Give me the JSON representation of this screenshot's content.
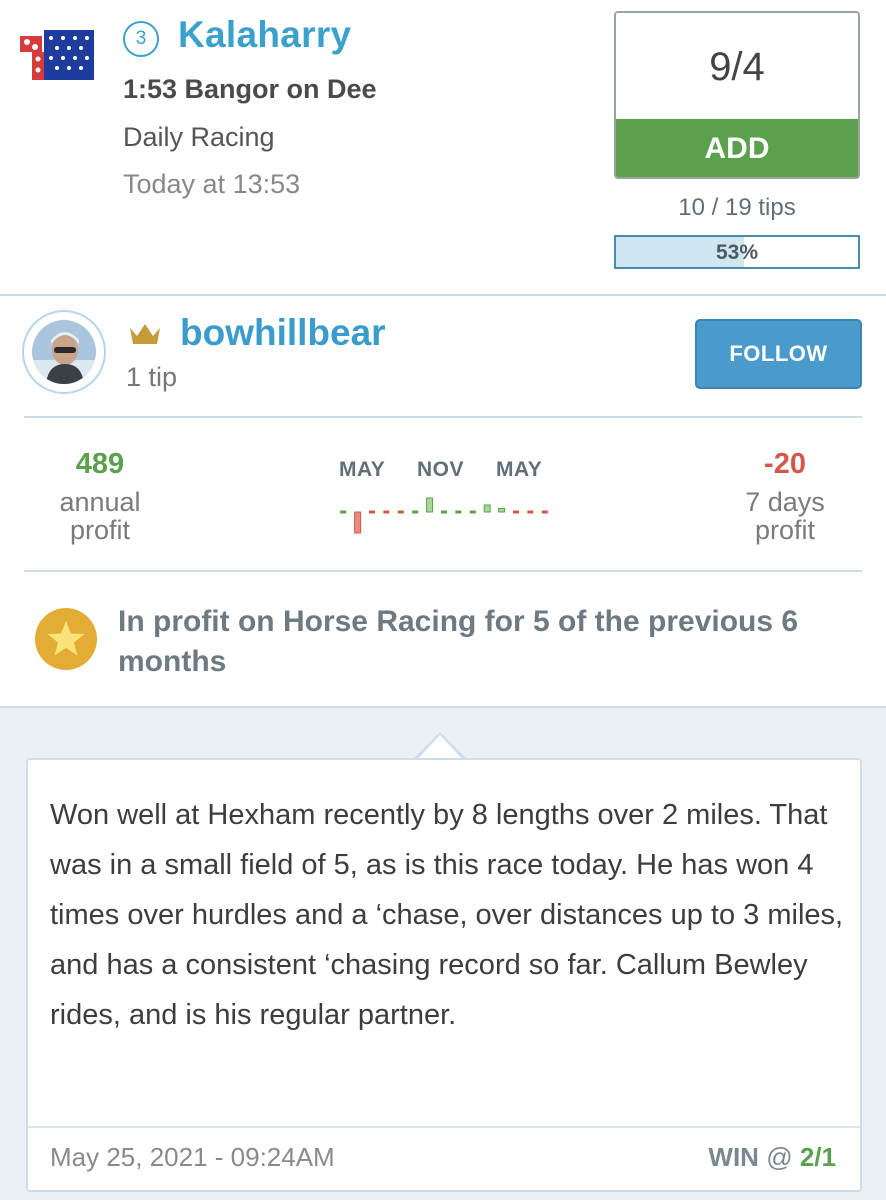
{
  "race": {
    "runner_number": "3",
    "horse_name": "Kalaharry",
    "race_title": "1:53 Bangor on Dee",
    "race_type": "Daily Racing",
    "race_time": "Today at 13:53",
    "odds": "9/4",
    "add_label": "ADD",
    "tips_count": "10 / 19 tips",
    "tips_percent_label": "53%",
    "tips_fraction": 0.53,
    "silks_colors": {
      "sleeves_red": "#d63a3a",
      "sleeves_white": "#ffffff",
      "body_blue": "#1e3c9e",
      "stars": "#ffffff"
    }
  },
  "tipster": {
    "name": "bowhillbear",
    "tip_count": "1 tip",
    "follow_label": "FOLLOW",
    "crown_icon": "crown-icon",
    "annual_profit_value": "489",
    "annual_profit_label": "annual profit",
    "week_profit_value": "-20",
    "week_profit_label": "7 days profit",
    "spark_months": [
      "MAY",
      "NOV",
      "MAY"
    ],
    "monthly_profit": [
      0,
      -3,
      0,
      0,
      0,
      0,
      2,
      0,
      0,
      0,
      1,
      0.5,
      0,
      0,
      0
    ],
    "achievement_text": "In profit on Horse Racing for 5 of the previous 6 months",
    "colors": {
      "profit": "#5aa04d",
      "loss": "#d4584a",
      "accent": "#3a9ccc"
    }
  },
  "comment": {
    "text": "Won well at Hexham recently by 8 lengths over 2 miles. That was in a small field of 5, as is this race today. He has won 4 times over hurdles and a ‘chase, over distances up to 3 miles, and has a consistent ‘chasing record so far. Callum Bewley rides, and is his regular partner.",
    "posted_at": "May 25, 2021 - 09:24AM",
    "bet_type": "WIN",
    "bet_at": "@",
    "bet_odds": "2/1"
  }
}
